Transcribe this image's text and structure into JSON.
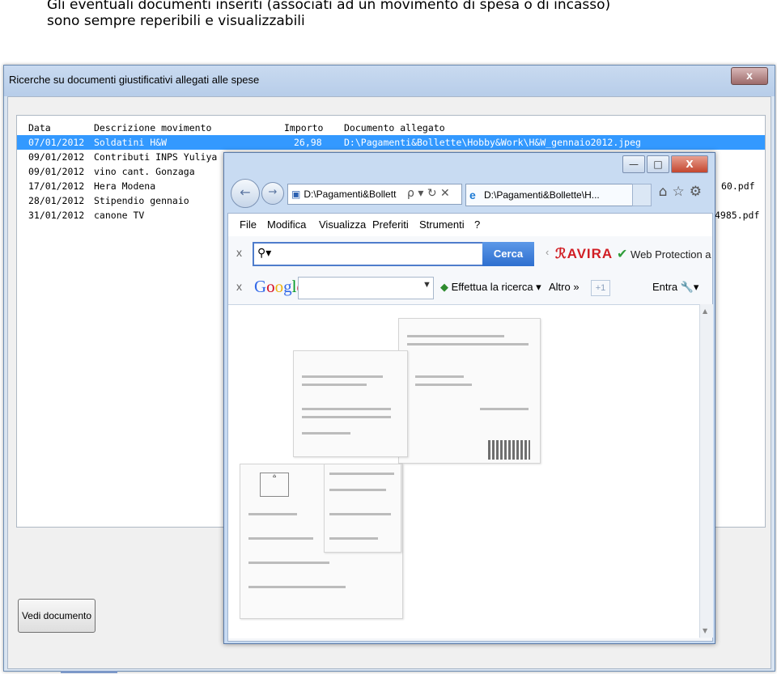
{
  "caption": {
    "line1": "Gli eventuali documenti inseriti (associati ad un movimento di spesa o di incasso)",
    "line2": "sono sempre reperibili e visualizzabili"
  },
  "window": {
    "title": "Ricerche su documenti giustificativi allegati alle spese",
    "close_label": "x"
  },
  "table": {
    "headers": [
      "Data",
      "Descrizione movimento",
      "Importo",
      "Documento allegato"
    ],
    "rows": [
      {
        "data": "07/01/2012",
        "descrizione": "Soldatini H&W",
        "importo": "26,98",
        "documento": "D:\\Pagamenti&Bollette\\Hobby&Work\\H&W_gennaio2012.jpeg"
      },
      {
        "data": "09/01/2012",
        "descrizione": "Contributi INPS Yuliya",
        "importo": "",
        "documento": ""
      },
      {
        "data": "09/01/2012",
        "descrizione": "vino cant. Gonzaga",
        "importo": "",
        "documento": ""
      },
      {
        "data": "17/01/2012",
        "descrizione": "Hera Modena",
        "importo": "",
        "documento": "60.pdf"
      },
      {
        "data": "28/01/2012",
        "descrizione": "Stipendio gennaio",
        "importo": "",
        "documento": ""
      },
      {
        "data": "31/01/2012",
        "descrizione": "canone TV",
        "importo": "",
        "documento": "4985.pdf"
      }
    ]
  },
  "button": {
    "vedi_documento": "Vedi documento"
  },
  "ie": {
    "address": "D:\\Pagamenti&Bollett",
    "address_tools": "ρ ▾ ↻ ✕",
    "tab_title": "D:\\Pagamenti&Bollette\\H...",
    "tab_close": "×",
    "menu": [
      "File",
      "Modifica",
      "Visualizza",
      "Preferiti",
      "Strumenti",
      "?"
    ],
    "search": {
      "x": "x",
      "button": "Cerca",
      "avira": "AVIRA",
      "web_protection": "Web Protection a"
    },
    "google_bar": {
      "x": "x",
      "logo": "Google",
      "effettua": "Effettua la ricerca",
      "altro": "Altro",
      "plus_one": "+1",
      "entra": "Entra"
    },
    "controls": {
      "minimize": "—",
      "maximize": "□",
      "close": "X"
    }
  },
  "colors": {
    "selection": "#3399ff",
    "cerca": "#2e6fcf",
    "avira": "#d11e24"
  }
}
